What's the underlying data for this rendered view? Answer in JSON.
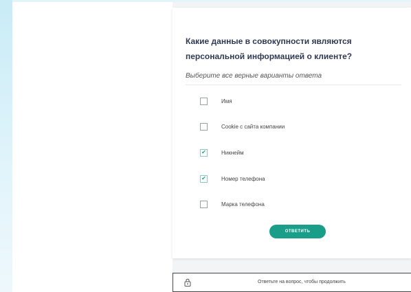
{
  "question": {
    "title": "Какие данные в совокупности являются персональной информацией о клиенте?",
    "instruction": "Выберите все верные варианты ответа"
  },
  "options": [
    {
      "label": "Имя",
      "checked": false
    },
    {
      "label": "Cookie с сайта компании",
      "checked": false
    },
    {
      "label": "Никнейм",
      "checked": true
    },
    {
      "label": "Номер телефона",
      "checked": true
    },
    {
      "label": "Марка телефона",
      "checked": false
    }
  ],
  "submit_button": {
    "label": "ответить"
  },
  "notice": {
    "text": "Ответьте на вопрос, чтобы продолжить",
    "icon": "lock-icon"
  },
  "colors": {
    "accent": "#1a9e8a",
    "title": "#2f3a52"
  }
}
